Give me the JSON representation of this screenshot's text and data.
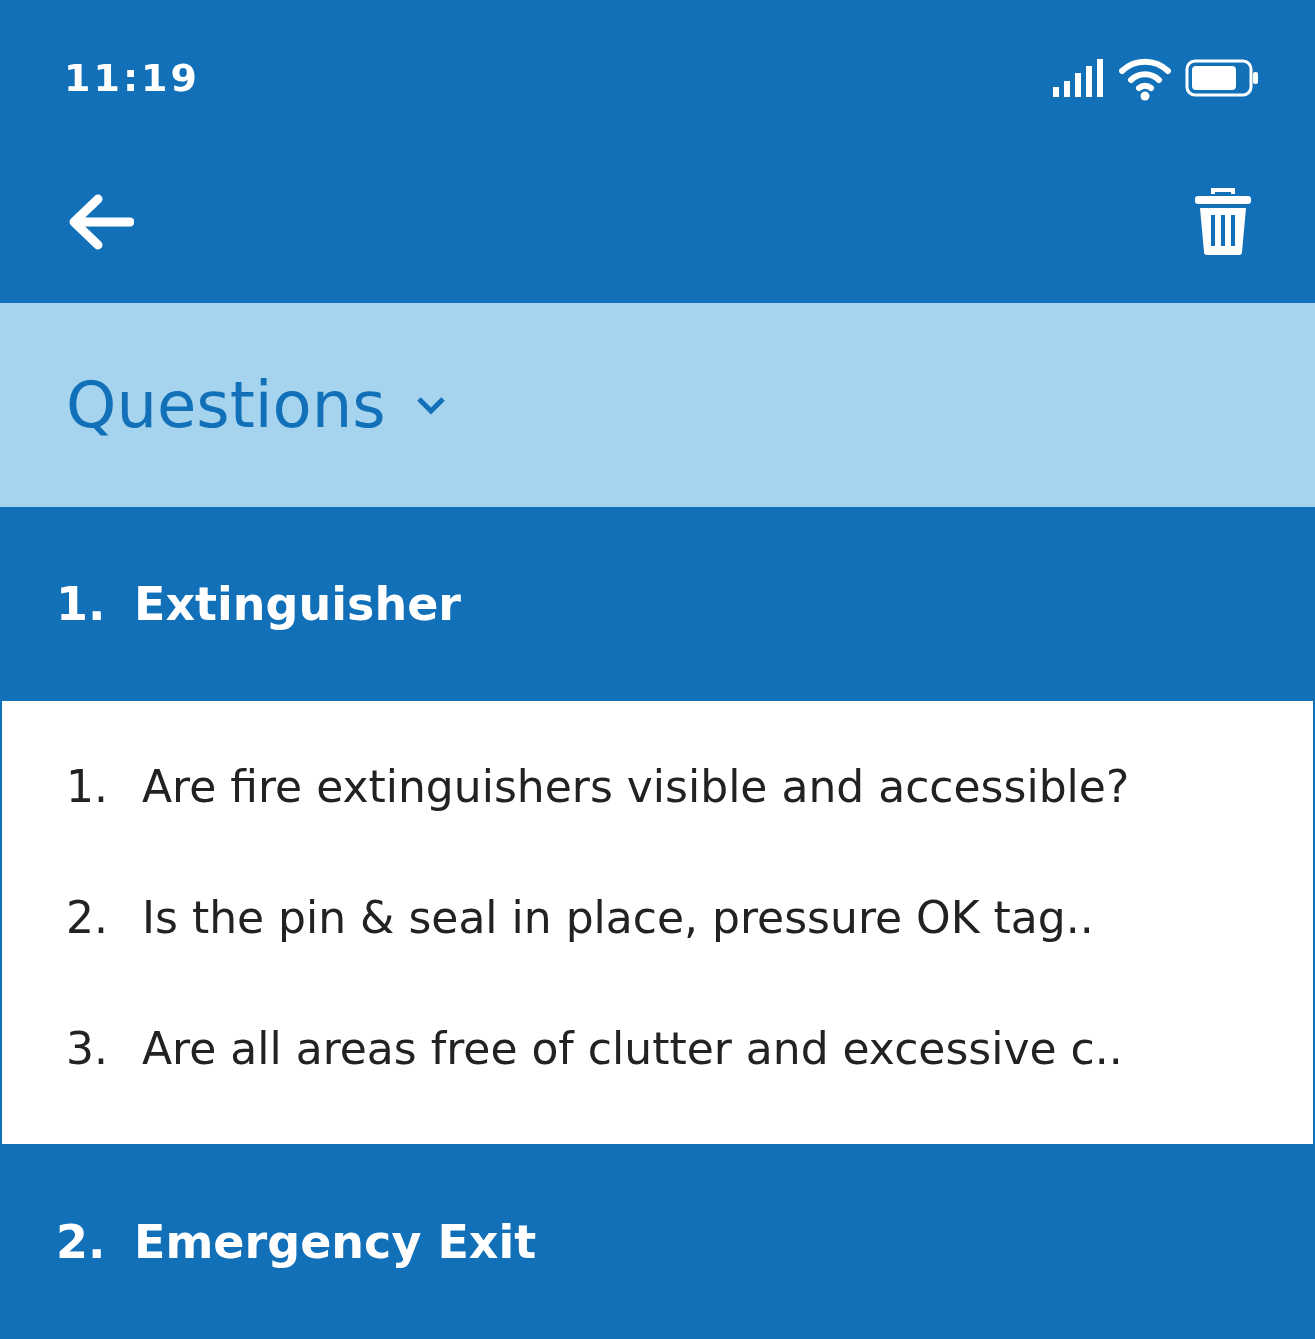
{
  "status_bar": {
    "time": "11:19"
  },
  "header": {
    "title": "Questions"
  },
  "sections": [
    {
      "number": "1.",
      "title": "Extinguisher",
      "expanded": true,
      "questions": [
        {
          "number": "1.",
          "text": "Are fire extinguishers visible and accessible?"
        },
        {
          "number": "2.",
          "text": "Is the pin & seal in place, pressure OK tag.."
        },
        {
          "number": "3.",
          "text": "Are all areas free of clutter and excessive c.."
        }
      ]
    },
    {
      "number": "2.",
      "title": "Emergency Exit",
      "expanded": false
    }
  ]
}
